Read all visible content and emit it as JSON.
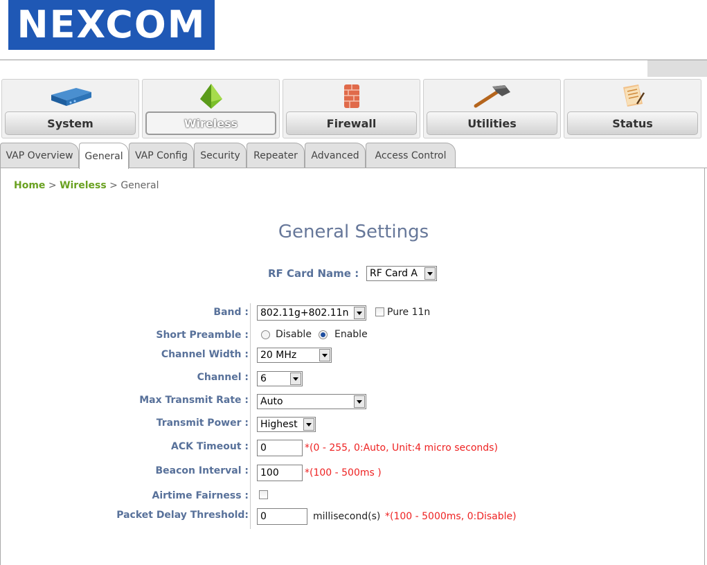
{
  "logo": {
    "text": "NEXCOM"
  },
  "nav": [
    {
      "label": "System",
      "icon": "router-icon"
    },
    {
      "label": "Wireless",
      "icon": "wireless-crystal-icon",
      "active": true
    },
    {
      "label": "Firewall",
      "icon": "firewall-brick-icon"
    },
    {
      "label": "Utilities",
      "icon": "hammer-icon"
    },
    {
      "label": "Status",
      "icon": "notepad-icon"
    }
  ],
  "subtabs": [
    {
      "label": "VAP Overview"
    },
    {
      "label": "General",
      "active": true
    },
    {
      "label": "VAP Config"
    },
    {
      "label": "Security"
    },
    {
      "label": "Repeater"
    },
    {
      "label": "Advanced"
    },
    {
      "label": "Access Control"
    }
  ],
  "breadcrumb": {
    "home": "Home",
    "sep1": " > ",
    "wireless": "Wireless",
    "sep2": " > ",
    "current": "General"
  },
  "page_title": "General Settings",
  "rf_card": {
    "label": "RF Card Name :",
    "value": "RF Card A"
  },
  "form": {
    "band": {
      "label": "Band :",
      "value": "802.11g+802.11n",
      "pure_label": "Pure 11n",
      "pure_checked": false
    },
    "short_preamble": {
      "label": "Short Preamble :",
      "options": [
        "Disable",
        "Enable"
      ],
      "selected": "Enable"
    },
    "channel_width": {
      "label": "Channel Width :",
      "value": "20 MHz"
    },
    "channel": {
      "label": "Channel :",
      "value": "6"
    },
    "max_rate": {
      "label": "Max Transmit Rate :",
      "value": "Auto"
    },
    "tx_power": {
      "label": "Transmit Power :",
      "value": "Highest"
    },
    "ack_timeout": {
      "label": "ACK Timeout :",
      "value": "0",
      "hint": "*(0 - 255, 0:Auto, Unit:4 micro seconds)"
    },
    "beacon": {
      "label": "Beacon Interval :",
      "value": "100",
      "hint": "*(100 - 500ms )"
    },
    "airtime": {
      "label": "Airtime Fairness :",
      "checked": false
    },
    "pkt_delay": {
      "label": "Packet Delay Threshold:",
      "value": "0",
      "unit": "millisecond(s)",
      "hint": "*(100 - 5000ms, 0:Disable)"
    }
  },
  "colors": {
    "label": "#58719a",
    "link": "#6aa121",
    "hint": "#ee2222",
    "logo_bg": "#1f58b5",
    "title": "#667799"
  }
}
